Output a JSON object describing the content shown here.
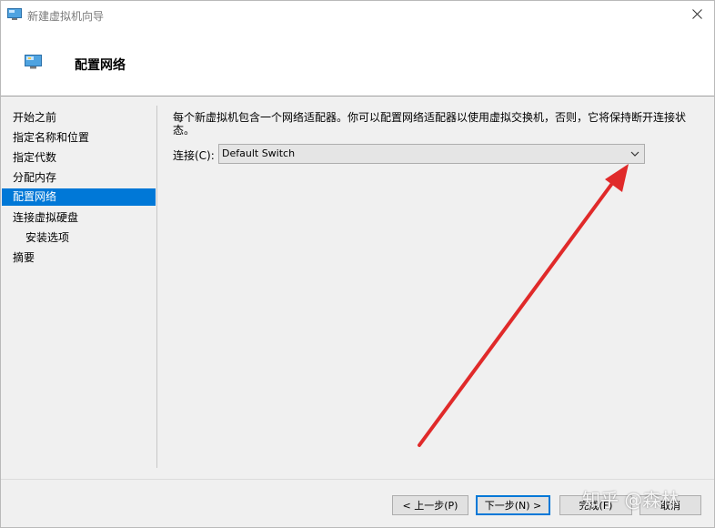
{
  "window": {
    "title": "新建虚拟机向导",
    "icon": "vm-monitor-icon",
    "close_icon": "close-icon"
  },
  "header": {
    "icon": "vm-monitor-icon",
    "title": "配置网络"
  },
  "sidebar": {
    "items": [
      {
        "label": "开始之前",
        "selected": false,
        "indent": false
      },
      {
        "label": "指定名称和位置",
        "selected": false,
        "indent": false
      },
      {
        "label": "指定代数",
        "selected": false,
        "indent": false
      },
      {
        "label": "分配内存",
        "selected": false,
        "indent": false
      },
      {
        "label": "配置网络",
        "selected": true,
        "indent": false
      },
      {
        "label": "连接虚拟硬盘",
        "selected": false,
        "indent": false
      },
      {
        "label": "安装选项",
        "selected": false,
        "indent": true
      },
      {
        "label": "摘要",
        "selected": false,
        "indent": false
      }
    ]
  },
  "main": {
    "description": "每个新虚拟机包含一个网络适配器。你可以配置网络适配器以使用虚拟交换机，否则，它将保持断开连接状态。",
    "connection": {
      "label": "连接(C):",
      "value": "Default Switch",
      "chevron_icon": "chevron-down-icon"
    }
  },
  "annotation": {
    "arrow_color": "#e02a2a"
  },
  "footer": {
    "buttons": {
      "previous": "< 上一步(P)",
      "next": "下一步(N) >",
      "finish": "完成(F)",
      "cancel": "取消"
    }
  },
  "watermark": "知乎 @森林",
  "colors": {
    "selection": "#0078d7",
    "panel_bg": "#f0f0f0"
  }
}
